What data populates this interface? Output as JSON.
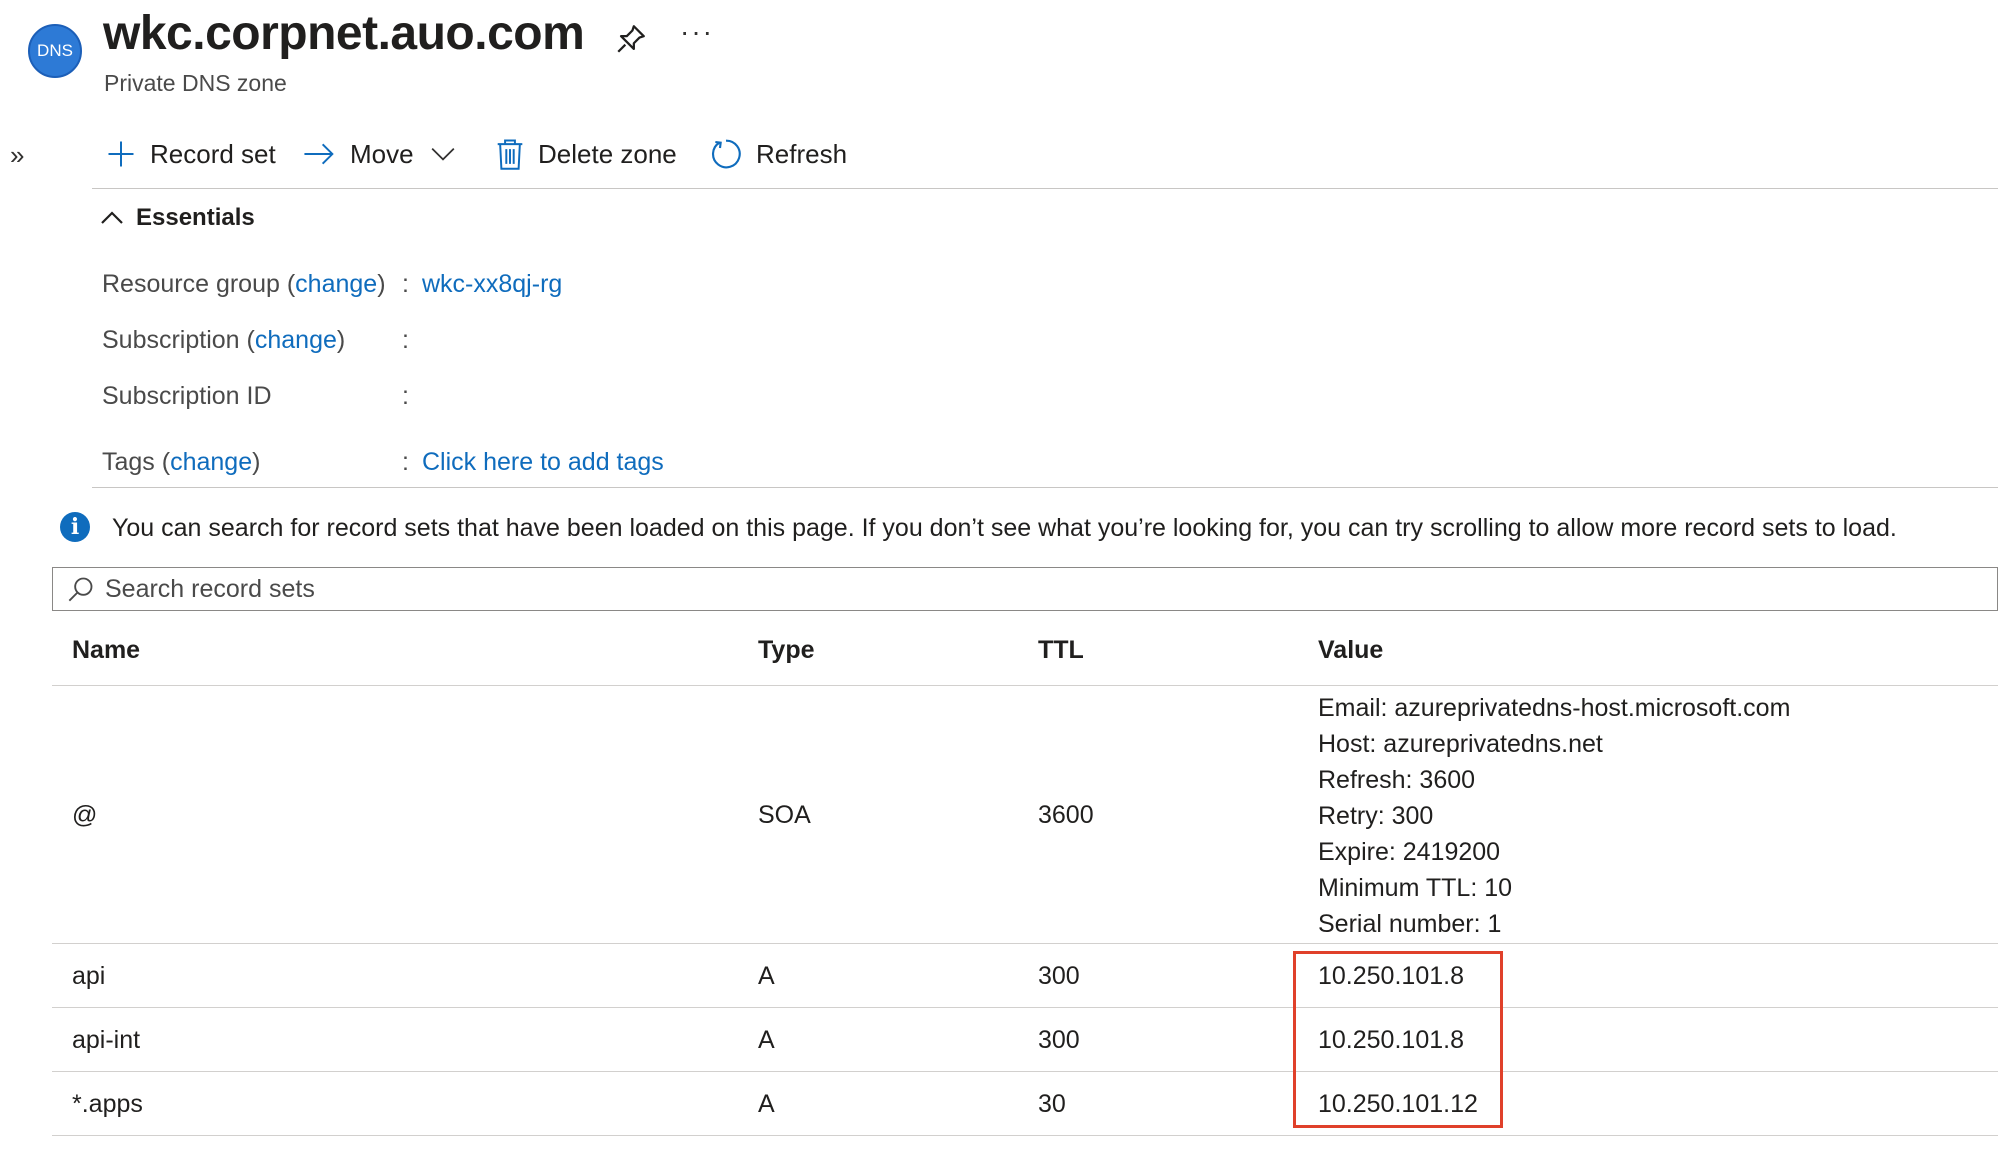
{
  "header": {
    "badge": "DNS",
    "title": "wkc.corpnet.auo.com",
    "subtitle": "Private DNS zone",
    "more": "···",
    "expand": "»"
  },
  "toolbar": {
    "record_set": "Record set",
    "move": "Move",
    "delete_zone": "Delete zone",
    "refresh": "Refresh"
  },
  "essentials": {
    "heading": "Essentials",
    "change": "change",
    "resource_group_label": "Resource group",
    "resource_group_value": "wkc-xx8qj-rg",
    "subscription_label": "Subscription",
    "subscription_id_label": "Subscription ID",
    "tags_label": "Tags",
    "tags_value": "Click here to add tags",
    "colon": ":"
  },
  "info": {
    "text": "You can search for record sets that have been loaded on this page. If you don’t see what you’re looking for, you can try scrolling to allow more record sets to load."
  },
  "search": {
    "placeholder": "Search record sets"
  },
  "table": {
    "headers": {
      "name": "Name",
      "type": "Type",
      "ttl": "TTL",
      "value": "Value"
    },
    "rows": [
      {
        "name": "@",
        "type": "SOA",
        "ttl": "3600",
        "value_lines": [
          "Email: azureprivatedns-host.microsoft.com",
          "Host: azureprivatedns.net",
          "Refresh: 3600",
          "Retry: 300",
          "Expire: 2419200",
          "Minimum TTL: 10",
          "Serial number: 1"
        ]
      },
      {
        "name": "api",
        "type": "A",
        "ttl": "300",
        "value": "10.250.101.8"
      },
      {
        "name": "api-int",
        "type": "A",
        "ttl": "300",
        "value": "10.250.101.8"
      },
      {
        "name": "*.apps",
        "type": "A",
        "ttl": "30",
        "value": "10.250.101.12"
      }
    ]
  },
  "colors": {
    "accent": "#0f6cbd",
    "highlight_box": "#e0402a"
  }
}
